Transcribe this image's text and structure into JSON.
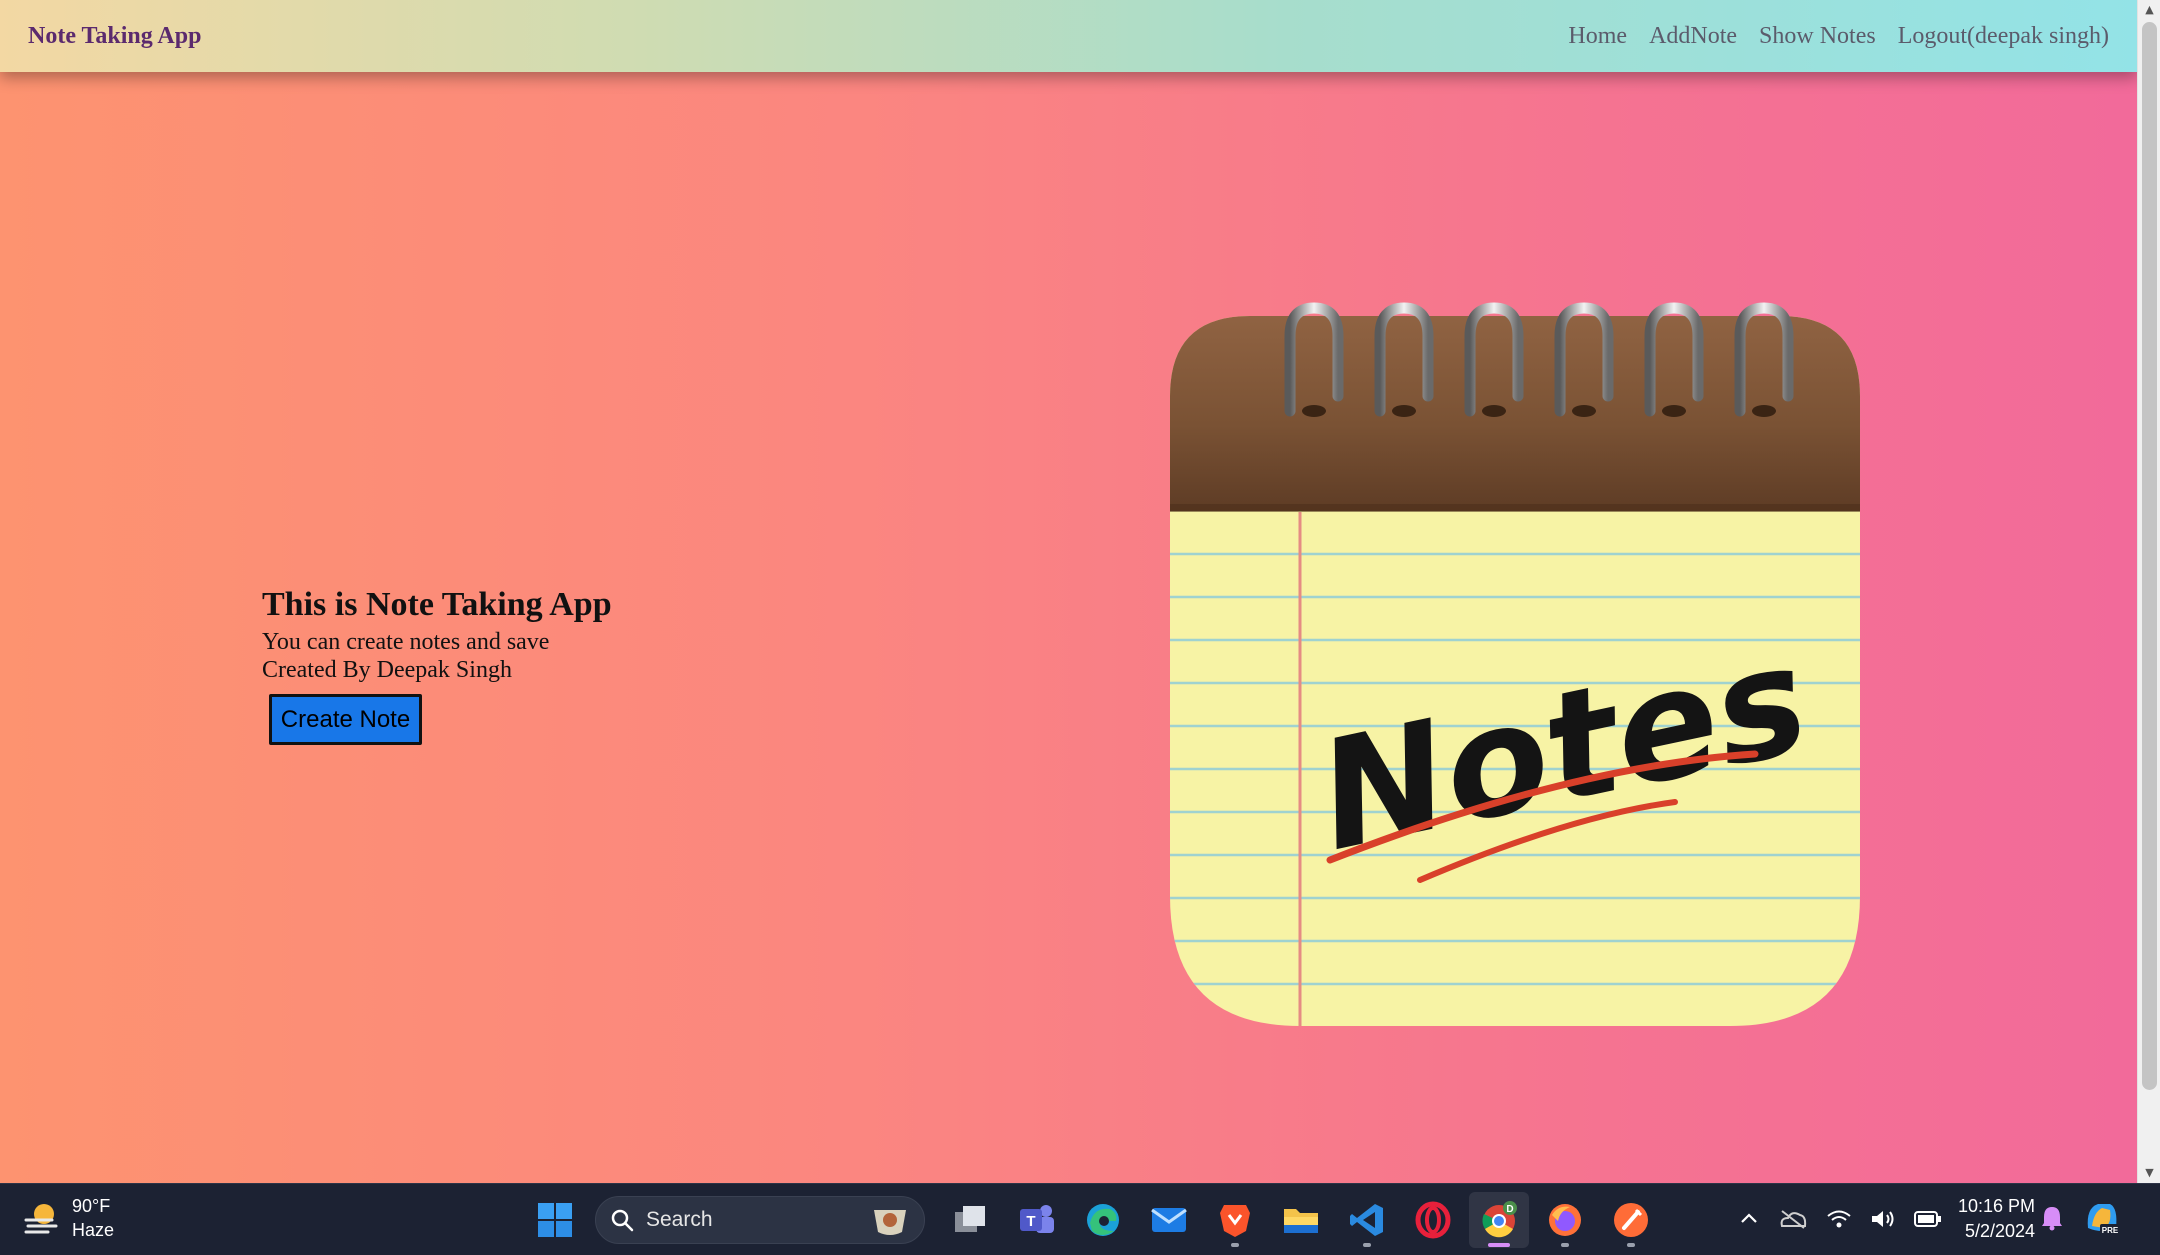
{
  "navbar": {
    "brand": "Note Taking App",
    "links": [
      "Home",
      "AddNote",
      "Show Notes",
      "Logout(deepak singh)"
    ]
  },
  "hero": {
    "title": "This is Note Taking App",
    "line1": "You can create notes and save",
    "line2": "Created By Deepak Singh",
    "button": "Create Note"
  },
  "logo": {
    "text": "Notes",
    "icon": "notes-notepad-logo"
  },
  "taskbar": {
    "weather": {
      "temp": "90°F",
      "condition": "Haze",
      "icon": "haze-icon"
    },
    "search_placeholder": "Search",
    "apps": [
      "start-icon",
      "search",
      "task-view-icon",
      "teams-icon",
      "edge-icon",
      "mail-icon",
      "brave-icon",
      "file-explorer-icon",
      "vscode-icon",
      "opera-icon",
      "chrome-icon",
      "firefox-icon",
      "postman-icon"
    ],
    "chrome_badge": "D",
    "time": "10:16 PM",
    "date": "5/2/2024",
    "copilot_badge": "PRE"
  },
  "colors": {
    "button": "#1877e8",
    "brand": "#5b2a6e",
    "taskbar": "#1c2233"
  }
}
